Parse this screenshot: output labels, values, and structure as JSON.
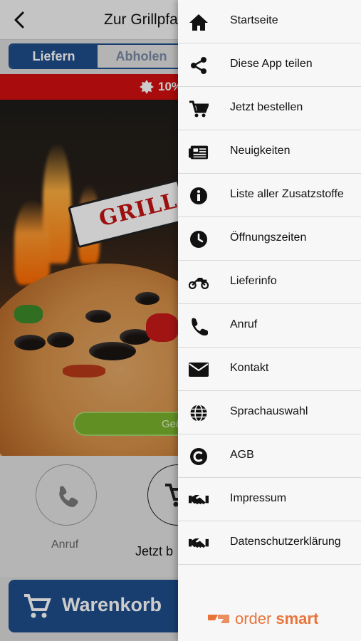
{
  "header": {
    "title": "Zur Grillpfan"
  },
  "order_mode": {
    "delivery_label": "Liefern",
    "pickup_label": "Abholen"
  },
  "promo": {
    "text": "10%"
  },
  "hero": {
    "logo_text": "GRILL",
    "button_label": "Geö"
  },
  "actions": [
    {
      "label": "Anruf"
    },
    {
      "label": "Jetzt b"
    }
  ],
  "cart": {
    "label": "Warenkorb"
  },
  "menu": {
    "items": [
      {
        "label": "Startseite",
        "icon": "home-icon"
      },
      {
        "label": "Diese App teilen",
        "icon": "share-icon"
      },
      {
        "label": "Jetzt bestellen",
        "icon": "cart-icon"
      },
      {
        "label": "Neuigkeiten",
        "icon": "news-icon"
      },
      {
        "label": "Liste aller Zusatzstoffe",
        "icon": "info-icon"
      },
      {
        "label": "Öffnungszeiten",
        "icon": "clock-icon"
      },
      {
        "label": "Lieferinfo",
        "icon": "motorcycle-icon"
      },
      {
        "label": "Anruf",
        "icon": "phone-icon"
      },
      {
        "label": "Kontakt",
        "icon": "envelope-icon"
      },
      {
        "label": "Sprachauswahl",
        "icon": "globe-icon"
      },
      {
        "label": "AGB",
        "icon": "copyright-icon"
      },
      {
        "label": "Impressum",
        "icon": "handshake-icon"
      },
      {
        "label": "Datenschutzerklärung",
        "icon": "handshake-icon"
      }
    ]
  },
  "brand": {
    "part1": "order",
    "part2": "smart"
  },
  "colors": {
    "primary": "#1f4e8c",
    "promo": "#d40f0f",
    "accent_green": "#7bb32e",
    "brand_orange": "#e8743a"
  }
}
